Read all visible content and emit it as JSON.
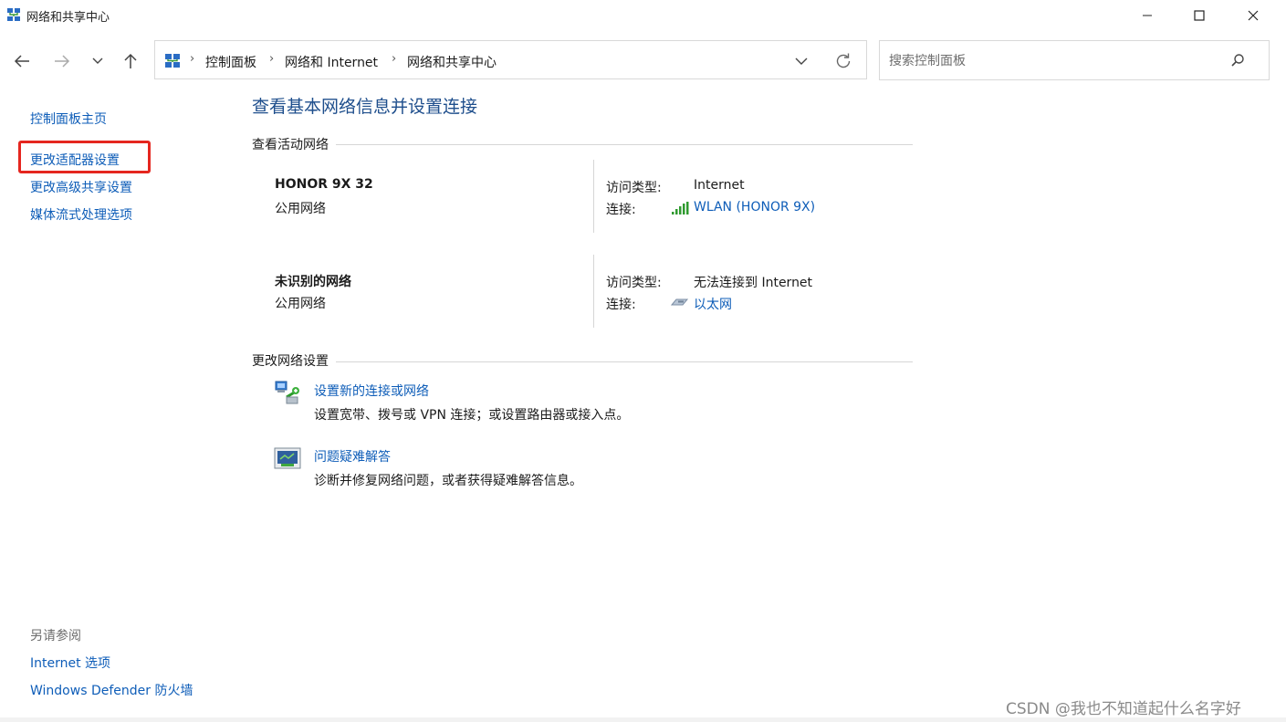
{
  "window": {
    "title": "网络和共享中心",
    "minimize_label": "Minimize",
    "maximize_label": "Maximize",
    "close_label": "Close"
  },
  "nav": {
    "breadcrumbs": [
      "控制面板",
      "网络和 Internet",
      "网络和共享中心"
    ],
    "search_placeholder": "搜索控制面板"
  },
  "sidebar": {
    "links": [
      "控制面板主页",
      "更改适配器设置",
      "更改高级共享设置",
      "媒体流式处理选项"
    ],
    "highlighted_index": 1,
    "see_also_heading": "另请参阅",
    "see_also_links": [
      "Internet 选项",
      "Windows Defender 防火墙"
    ]
  },
  "main": {
    "title": "查看基本网络信息并设置连接",
    "active_networks_heading": "查看活动网络",
    "networks": [
      {
        "name": "HONOR 9X 32",
        "type": "公用网络",
        "access_label": "访问类型:",
        "access_value": "Internet",
        "connection_label": "连接:",
        "connection_value": "WLAN (HONOR 9X)",
        "connection_icon": "wifi-signal-icon"
      },
      {
        "name": "未识别的网络",
        "type": "公用网络",
        "access_label": "访问类型:",
        "access_value": "无法连接到 Internet",
        "connection_label": "连接:",
        "connection_value": "以太网",
        "connection_icon": "ethernet-icon"
      }
    ],
    "change_settings_heading": "更改网络设置",
    "tasks": [
      {
        "link": "设置新的连接或网络",
        "description": "设置宽带、拨号或 VPN 连接；或设置路由器或接入点。",
        "icon": "new-connection-icon"
      },
      {
        "link": "问题疑难解答",
        "description": "诊断并修复网络问题，或者获得疑难解答信息。",
        "icon": "troubleshoot-icon"
      }
    ]
  },
  "watermark": "CSDN @我也不知道起什么名字好",
  "colors": {
    "link": "#0e5db8",
    "title": "#1e4e8c",
    "highlight": "#e5261f"
  }
}
